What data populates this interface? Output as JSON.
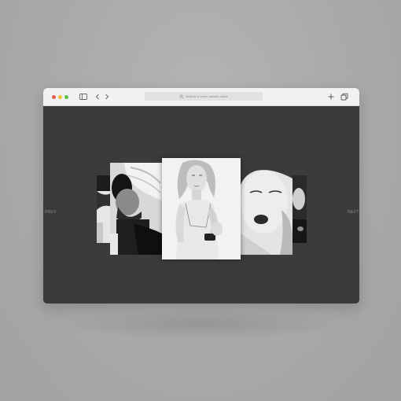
{
  "browser": {
    "address_placeholder": "Search or enter website name",
    "traffic_lights": {
      "close": "#ec5b52",
      "minimize": "#f1bb33",
      "zoom": "#5cc146"
    },
    "icons": [
      "sidebar-icon",
      "back-icon",
      "forward-icon",
      "search-icon",
      "new-tab-icon",
      "tabs-overview-icon"
    ]
  },
  "gallery": {
    "prev_label": "PREV",
    "next_label": "NEXT",
    "photos": [
      {
        "position": "far-left",
        "subject": "partial black and white photo"
      },
      {
        "position": "left",
        "subject": "bearded man leaning on pillow"
      },
      {
        "position": "center",
        "subject": "blonde woman with wristwatch"
      },
      {
        "position": "right",
        "subject": "woman with dark lips"
      },
      {
        "position": "far-right",
        "subject": "partial black and white portrait"
      }
    ]
  }
}
